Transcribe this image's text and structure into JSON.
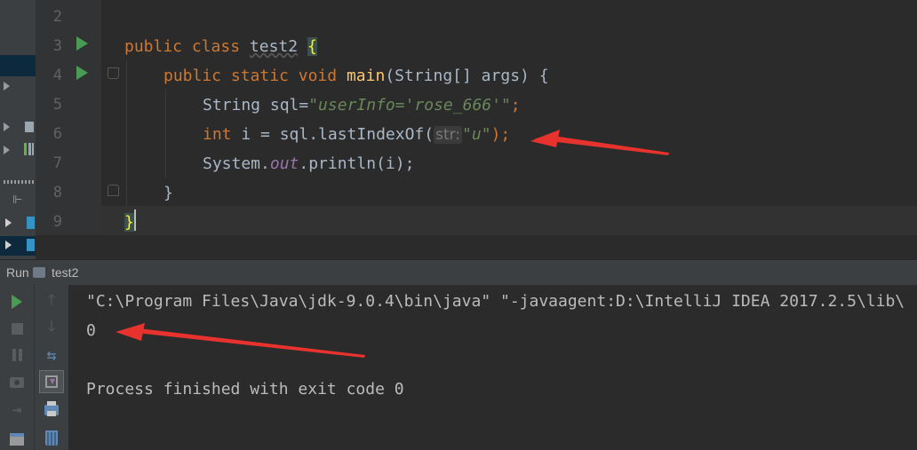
{
  "editor": {
    "line_numbers": [
      "2",
      "3",
      "4",
      "5",
      "6",
      "7",
      "8",
      "9"
    ],
    "class_line": {
      "kw1": "public",
      "kw2": "class",
      "name": "test2",
      "brace": "{"
    },
    "main_line": {
      "kw1": "public",
      "kw2": "static",
      "kw3": "void",
      "method": "main",
      "params": "(String[] args) {"
    },
    "sql_line": {
      "prefix": "String sql=",
      "string": "\"userInfo='rose_666'\"",
      "suffix": ";"
    },
    "int_line": {
      "kw": "int",
      "mid": " i = sql.lastIndexOf(",
      "hint": "str:",
      "string": "\"u\"",
      "suffix": ");"
    },
    "println_line": {
      "prefix": "System.",
      "out": "out",
      "suffix": ".println(i);"
    },
    "close_method": "}",
    "close_class": "}"
  },
  "run_panel": {
    "tab_label": "Run",
    "config_name": "test2",
    "console_lines": {
      "command": "\"C:\\Program Files\\Java\\jdk-9.0.4\\bin\\java\" \"-javaagent:D:\\IntelliJ IDEA 2017.2.5\\lib\\",
      "output": "0",
      "finished": "Process finished with exit code 0"
    }
  },
  "colors": {
    "keyword": "#cc7832",
    "method": "#ffc66d",
    "string": "#6a8759",
    "static_field": "#9876aa",
    "run_green": "#499c54",
    "annotation_arrow": "#e8322d"
  },
  "icons": {
    "gutter": "run-arrow-icon",
    "toolbar": [
      "rerun-icon",
      "stop-icon",
      "pause-icon",
      "camera-icon",
      "exit-icon",
      "scroll-up-icon",
      "scroll-down-icon",
      "soft-wrap-icon",
      "scroll-to-end-icon",
      "print-icon",
      "trash-icon"
    ]
  }
}
